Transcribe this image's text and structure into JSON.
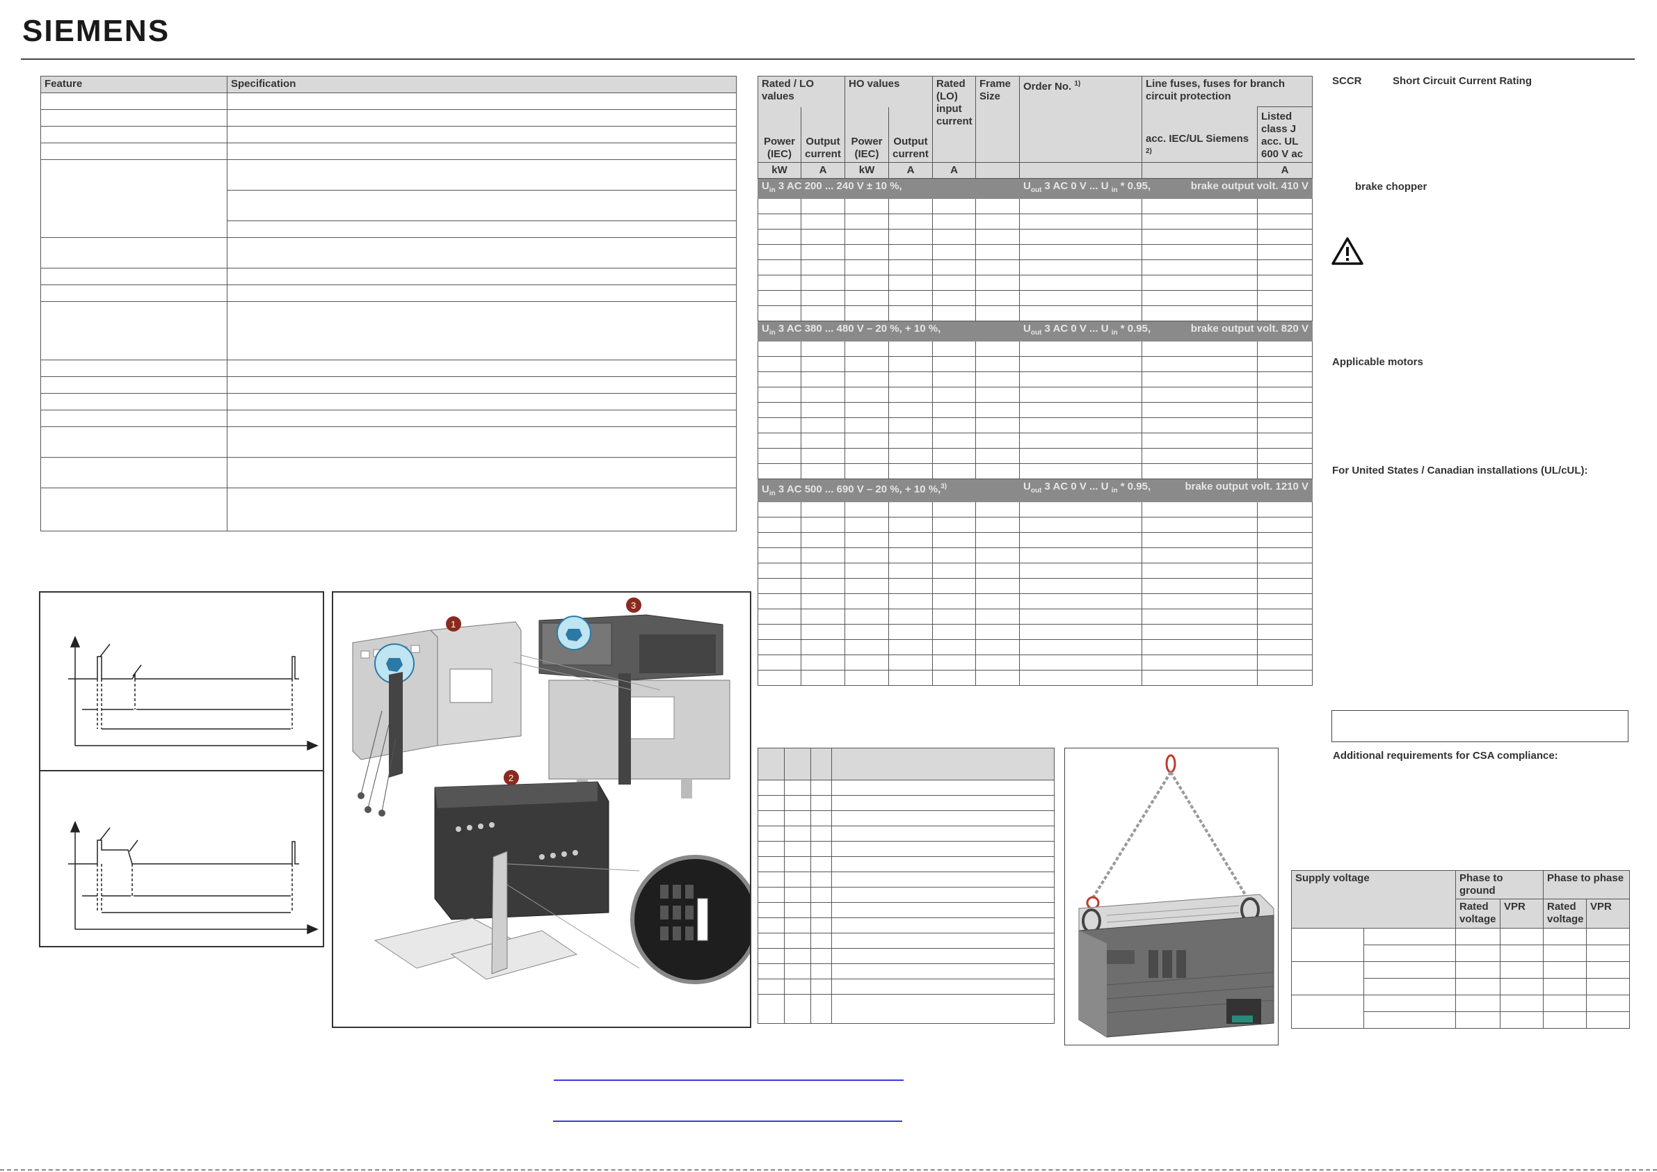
{
  "brand": "SIEMENS",
  "feature_table": {
    "headers": [
      "Feature",
      "Specification"
    ]
  },
  "rating_table": {
    "header": {
      "rated_lo": "Rated / LO values",
      "ho": "HO values",
      "rated_lo_input": "Rated (LO) input current",
      "frame": "Frame Size",
      "order": "Order No.",
      "order_sup": "1)",
      "fuses": "Line fuses, fuses for branch circuit protection",
      "power_iec_1": "Power (IEC)",
      "output_current_1": "Output current",
      "power_iec_2": "Power (IEC)",
      "output_current_2": "Output current",
      "acc_iec": "acc. IEC/UL Siemens",
      "acc_iec_sup": "2)",
      "listed": "Listed class J acc. UL 600 V ac"
    },
    "units": [
      "kW",
      "A",
      "kW",
      "A",
      "A",
      "",
      "",
      "",
      "A"
    ],
    "bands": [
      {
        "left": "U",
        "sub_in": "in",
        "l2": "3 AC 200 ... 240 V ± 10 %,",
        "mid": "U",
        "sub_out": "out",
        "m2": "3 AC 0 V ... U",
        "sub_in2": "in",
        "m3": "* 0.95,",
        "right": "brake output volt. 410 V"
      },
      {
        "left": "U",
        "sub_in": "in",
        "l2": "3 AC 380 ... 480 V – 20 %, + 10 %,",
        "mid": "U",
        "sub_out": "out",
        "m2": "3 AC 0 V ... U",
        "sub_in2": "in",
        "m3": "* 0.95,",
        "right": "brake output volt. 820 V"
      },
      {
        "left": "U",
        "sub_in": "in",
        "l2": "3 AC 500 ... 690 V – 20 %, + 10 %,",
        "sup": "3)",
        "mid": "U",
        "sub_out": "out",
        "m2": "3 AC 0 V ... U",
        "sub_in2": "in",
        "m3": "* 0.95,",
        "right": "brake output volt. 1210 V"
      }
    ]
  },
  "right_notes": {
    "sccr": "SCCR",
    "sccr_desc": "Short Circuit Current Rating",
    "brake": "brake chopper",
    "applicable": "Applicable motors",
    "ul": "For United States / Canadian installations (UL/cUL):",
    "csa": "Additional requirements for CSA compliance:"
  },
  "supply_table": {
    "supply": "Supply voltage",
    "p2g": "Phase to ground",
    "p2p": "Phase to phase",
    "rated": "Rated voltage",
    "vpr": "VPR"
  },
  "figures": {
    "step1": "1",
    "step2": "2",
    "step3": "3"
  }
}
